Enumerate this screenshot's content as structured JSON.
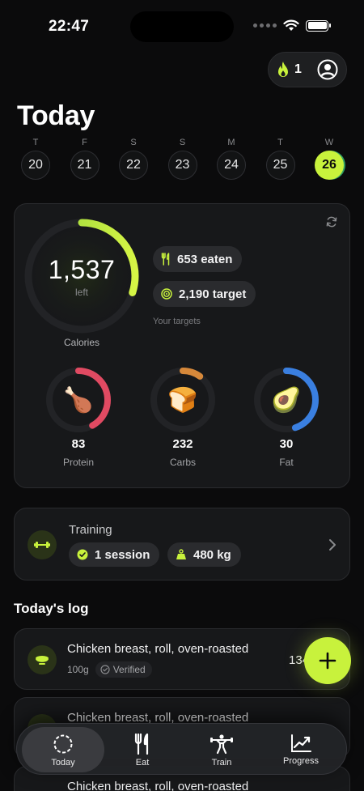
{
  "status_bar": {
    "time": "22:47"
  },
  "header": {
    "streak_count": "1",
    "title": "Today"
  },
  "week": [
    {
      "letter": "T",
      "date": "20"
    },
    {
      "letter": "F",
      "date": "21"
    },
    {
      "letter": "S",
      "date": "22"
    },
    {
      "letter": "S",
      "date": "23"
    },
    {
      "letter": "M",
      "date": "24"
    },
    {
      "letter": "T",
      "date": "25"
    },
    {
      "letter": "W",
      "date": "26",
      "selected": true
    }
  ],
  "calories": {
    "remaining": "1,537",
    "remaining_label": "left",
    "label": "Calories",
    "progress": 0.3,
    "eaten": "653 eaten",
    "target": "2,190 target",
    "targets_label": "Your targets"
  },
  "macros": [
    {
      "name": "Protein",
      "value": "83",
      "emoji": "🍗",
      "color": "#e04a62",
      "progress": 0.42
    },
    {
      "name": "Carbs",
      "value": "232",
      "emoji": "🍞",
      "color": "#d6883a",
      "progress": 0.1
    },
    {
      "name": "Fat",
      "value": "30",
      "emoji": "🥑",
      "color": "#3a7fe0",
      "progress": 0.45
    }
  ],
  "training": {
    "title": "Training",
    "sessions": "1 session",
    "volume": "480 kg"
  },
  "log": {
    "title": "Today's log",
    "items": [
      {
        "name": "Chicken breast, roll, oven-roasted",
        "amount": "100g",
        "badge": "Verified",
        "kcal": "134"
      },
      {
        "name": "Chicken breast, roll, oven-roasted",
        "amount": "",
        "badge": "",
        "kcal": ""
      },
      {
        "name": "Chicken breast, roll, oven-roasted",
        "amount": "",
        "badge": "",
        "kcal": ""
      }
    ]
  },
  "tabs": [
    {
      "label": "Today",
      "icon": "today-icon"
    },
    {
      "label": "Eat",
      "icon": "fork-knife-icon"
    },
    {
      "label": "Train",
      "icon": "weightlifter-icon"
    },
    {
      "label": "Progress",
      "icon": "chart-icon"
    }
  ],
  "colors": {
    "accent": "#c8f23c",
    "background": "#0b0b0c",
    "card": "#17181a"
  }
}
